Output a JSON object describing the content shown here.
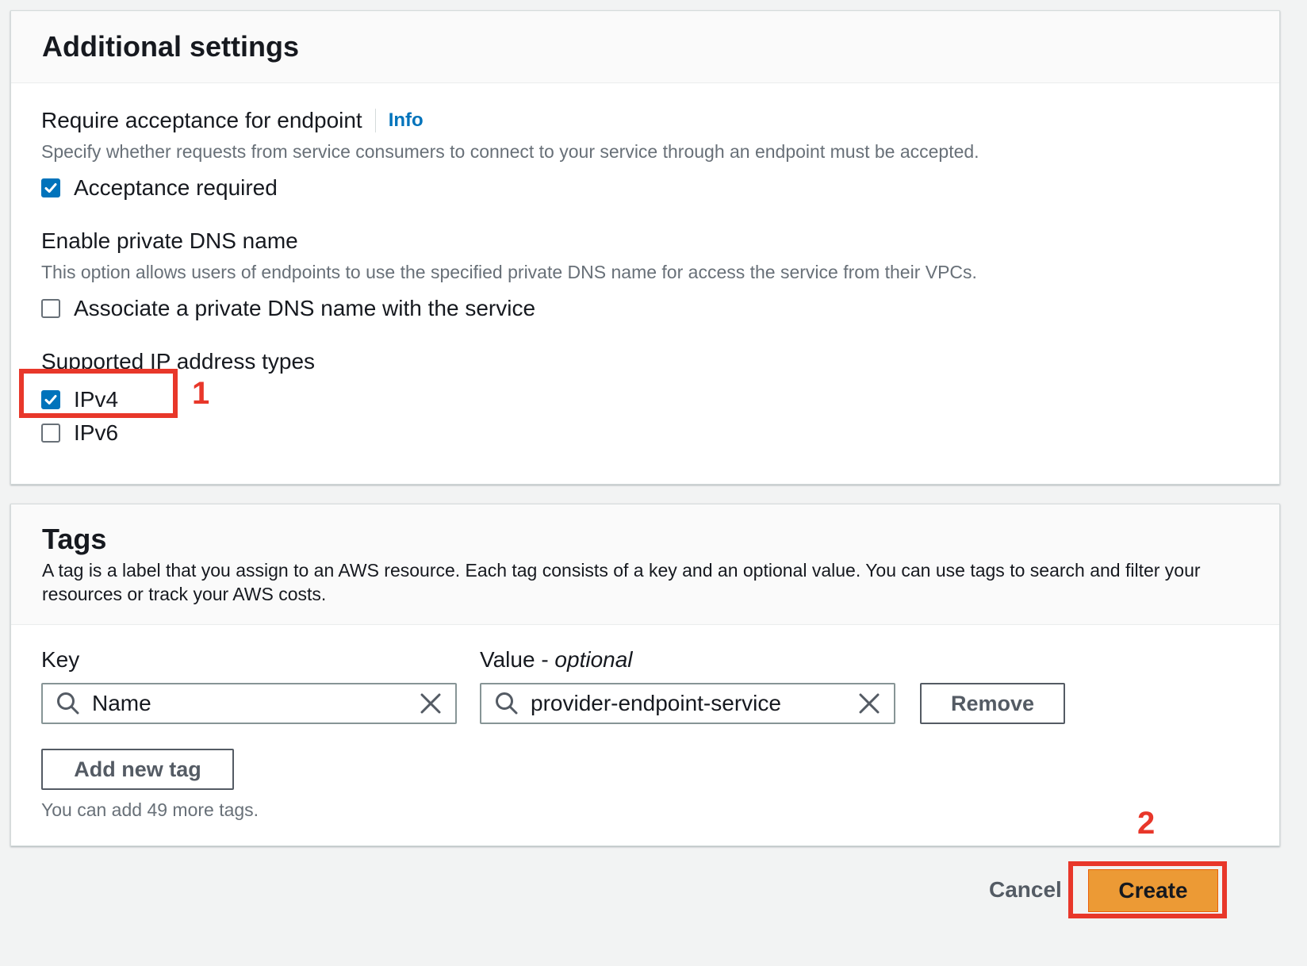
{
  "additional_settings": {
    "title": "Additional settings",
    "acceptance": {
      "label": "Require acceptance for endpoint",
      "info_link": "Info",
      "description": "Specify whether requests from service consumers to connect to your service through an endpoint must be accepted.",
      "checkbox_label": "Acceptance required",
      "checked": true
    },
    "private_dns": {
      "label": "Enable private DNS name",
      "description": "This option allows users of endpoints to use the specified private DNS name for access the service from their VPCs.",
      "checkbox_label": "Associate a private DNS name with the service",
      "checked": false
    },
    "ip_types": {
      "label": "Supported IP address types",
      "options": [
        {
          "label": "IPv4",
          "checked": true
        },
        {
          "label": "IPv6",
          "checked": false
        }
      ]
    }
  },
  "tags": {
    "title": "Tags",
    "description": "A tag is a label that you assign to an AWS resource. Each tag consists of a key and an optional value. You can use tags to search and filter your resources or track your AWS costs.",
    "key_label": "Key",
    "value_label": "Value - ",
    "value_label_optional": "optional",
    "key_value": "Name",
    "value_value": "provider-endpoint-service",
    "remove_label": "Remove",
    "add_label": "Add new tag",
    "limit_text": "You can add 49 more tags."
  },
  "footer": {
    "cancel_label": "Cancel",
    "create_label": "Create"
  },
  "annotations": {
    "marker_1": "1",
    "marker_2": "2",
    "color": "#e8372a"
  },
  "icons": [
    "check-icon",
    "search-icon",
    "clear-icon"
  ],
  "colors": {
    "primary_button": "#ec9a35",
    "link": "#0073bb",
    "checkbox_checked": "#0073bb"
  }
}
